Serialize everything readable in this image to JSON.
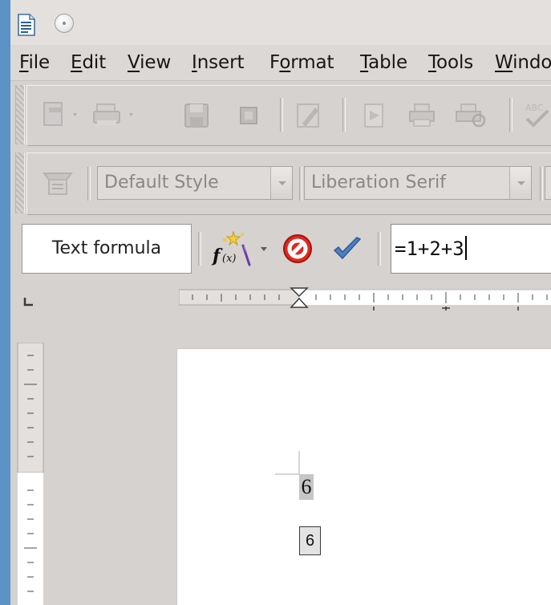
{
  "window": {
    "title_icon": "writer-document-icon",
    "accent": "#5b93c4"
  },
  "menubar": {
    "items": [
      {
        "underlined": "F",
        "rest": "ile"
      },
      {
        "underlined": "E",
        "rest": "dit"
      },
      {
        "underlined": "V",
        "rest": "iew"
      },
      {
        "underlined": "I",
        "rest": "nsert"
      },
      {
        "before": "F",
        "underlined": "o",
        "rest": "rmat"
      },
      {
        "underlined": "T",
        "rest": "able"
      },
      {
        "underlined": "T",
        "rest": "ools"
      },
      {
        "underlined": "W",
        "rest": "indo"
      }
    ]
  },
  "formatting": {
    "paragraph_style": "Default Style",
    "font_name": "Liberation Serif"
  },
  "formula_bar": {
    "name_box": "Text formula",
    "formula": "=1+2+3"
  },
  "document": {
    "field_value_shaded": "6",
    "field_value_boxed": "6"
  }
}
